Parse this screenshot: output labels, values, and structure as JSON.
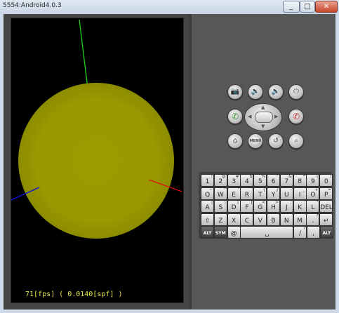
{
  "window": {
    "title": "5554:Android4.0.3",
    "buttons": {
      "minimize": "_",
      "maximize": "□",
      "close": "✕"
    }
  },
  "screen": {
    "fps_text": "71[fps] ( 0.0140[spf] )",
    "sphere_color": "#9b9b00",
    "axis_colors": {
      "y": "#19d219",
      "x": "#e01010",
      "z": "#1010e0"
    }
  },
  "controls": {
    "camera": "📷",
    "volume_down": "🔉",
    "volume_up": "🔊",
    "power": "⏻",
    "call": "✆",
    "end_call": "✆",
    "home": "⌂",
    "menu": "MENU",
    "back": "↺",
    "search": "⌕",
    "dpad_arrows": {
      "up": "▲",
      "down": "▼",
      "left": "◀",
      "right": "▶"
    }
  },
  "keyboard": {
    "rows": [
      [
        {
          "main": "1",
          "sub": "!"
        },
        {
          "main": "2",
          "sub": "@"
        },
        {
          "main": "3",
          "sub": "#"
        },
        {
          "main": "4",
          "sub": "$"
        },
        {
          "main": "5",
          "sub": "%"
        },
        {
          "main": "6",
          "sub": "^"
        },
        {
          "main": "7",
          "sub": "&"
        },
        {
          "main": "8",
          "sub": "*"
        },
        {
          "main": "9",
          "sub": "("
        },
        {
          "main": "0",
          "sub": ")"
        }
      ],
      [
        {
          "main": "Q",
          "sub": "~"
        },
        {
          "main": "W",
          "sub": "\""
        },
        {
          "main": "E",
          "sub": "'"
        },
        {
          "main": "R",
          "sub": "`"
        },
        {
          "main": "T",
          "sub": "{"
        },
        {
          "main": "Y",
          "sub": "}"
        },
        {
          "main": "U",
          "sub": "-"
        },
        {
          "main": "I",
          "sub": "_"
        },
        {
          "main": "O",
          "sub": "+"
        },
        {
          "main": "P",
          "sub": "="
        }
      ],
      [
        {
          "main": "A",
          "sub": "|"
        },
        {
          "main": "S",
          "sub": "\\"
        },
        {
          "main": "D",
          "sub": "["
        },
        {
          "main": "F",
          "sub": "]"
        },
        {
          "main": "G",
          "sub": "<"
        },
        {
          "main": "H",
          "sub": ">"
        },
        {
          "main": "J",
          "sub": ";"
        },
        {
          "main": "K",
          "sub": ":"
        },
        {
          "main": "L",
          "sub": "\""
        },
        {
          "main": "DEL",
          "sub": ""
        }
      ],
      [
        {
          "main": "⇧",
          "sub": ""
        },
        {
          "main": "Z",
          "sub": ""
        },
        {
          "main": "X",
          "sub": ""
        },
        {
          "main": "C",
          "sub": ""
        },
        {
          "main": "V",
          "sub": ""
        },
        {
          "main": "B",
          "sub": ""
        },
        {
          "main": "N",
          "sub": ""
        },
        {
          "main": "M",
          "sub": ""
        },
        {
          "main": ".",
          "sub": "?"
        },
        {
          "main": "↵",
          "sub": ""
        }
      ],
      [
        {
          "main": "ALT",
          "sub": ""
        },
        {
          "main": "SYM",
          "sub": ""
        },
        {
          "main": "@",
          "sub": ""
        },
        {
          "main": "␣",
          "sub": ""
        },
        {
          "main": "/",
          "sub": "?"
        },
        {
          "main": ",",
          "sub": ""
        },
        {
          "main": "ALT",
          "sub": ""
        }
      ]
    ]
  }
}
